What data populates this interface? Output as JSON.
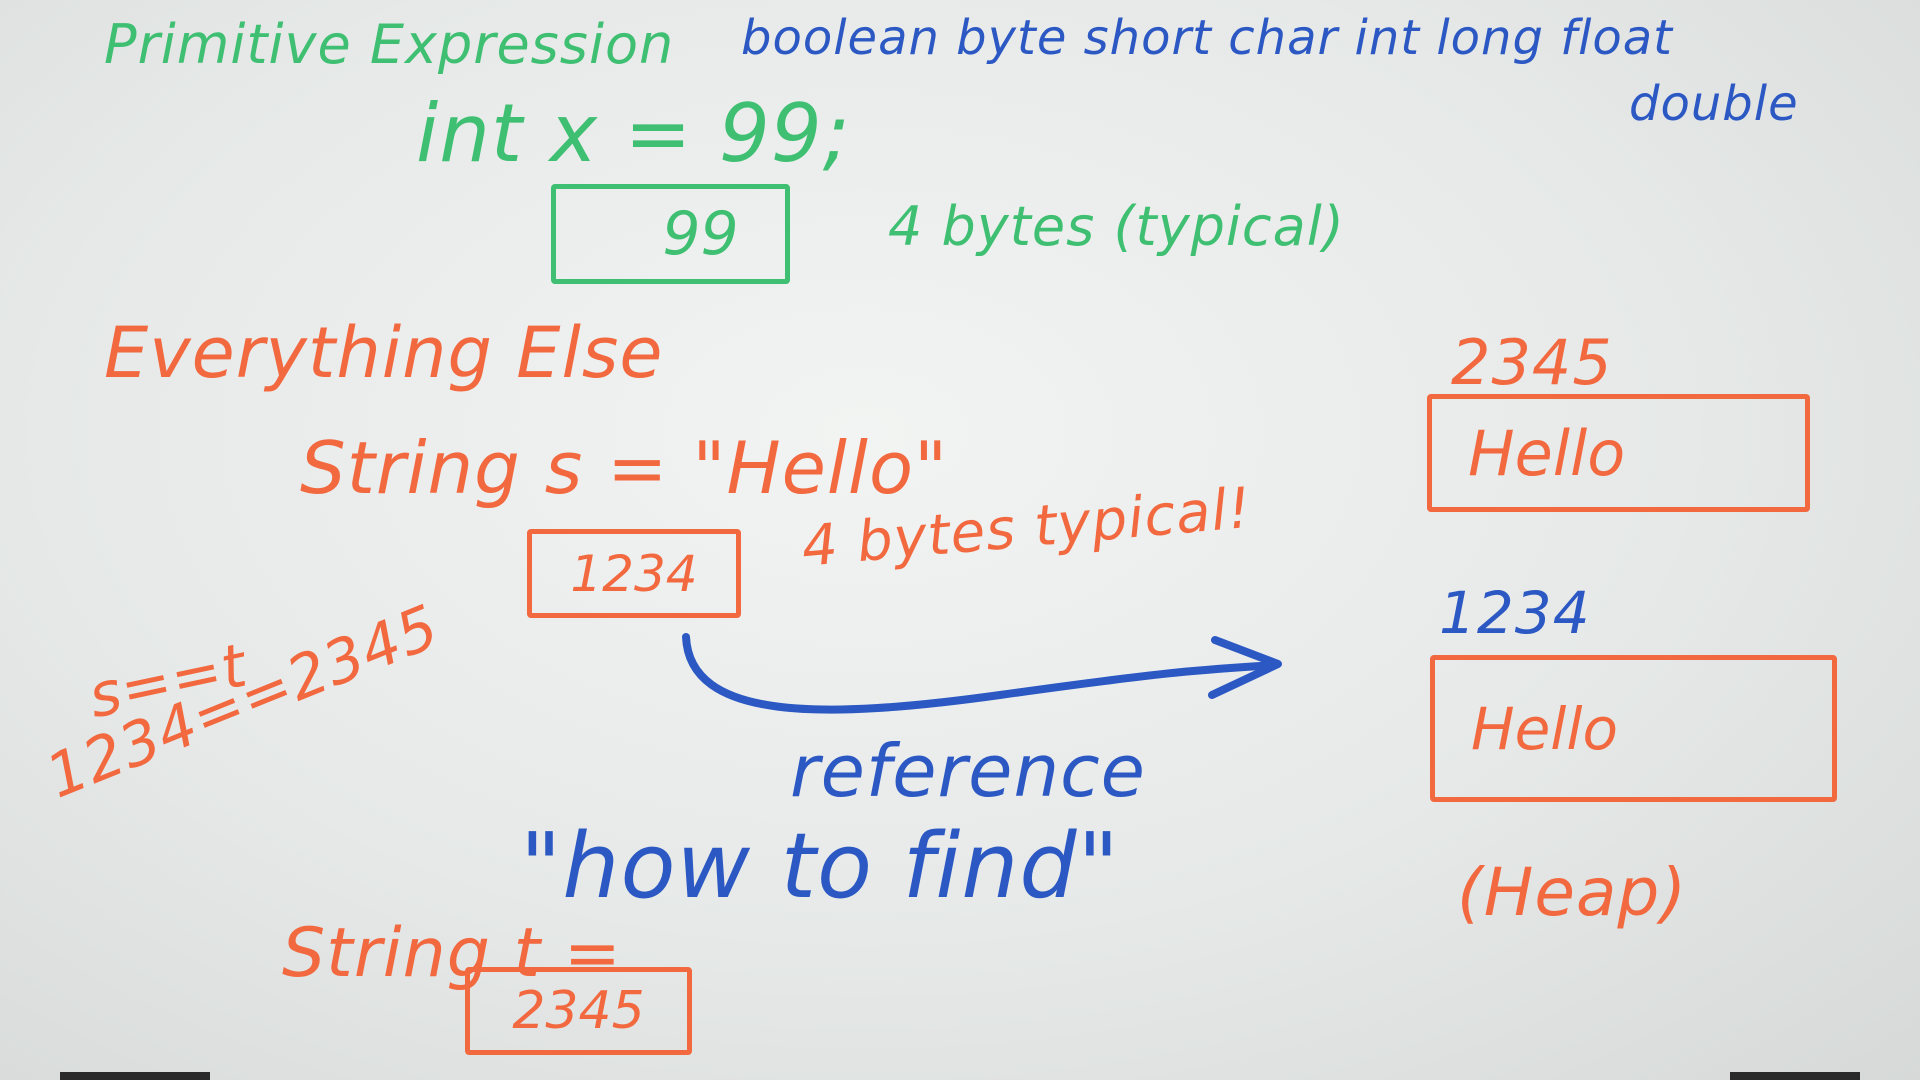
{
  "primitive": {
    "title": "Primitive Expression",
    "types": "boolean byte short char int long float",
    "types_cont": "double",
    "declaration": "int x = 99;",
    "box_value": "99",
    "size_note": "4 bytes (typical)"
  },
  "everything_else": {
    "title": "Everything Else",
    "declaration_s": "String s = \"Hello\"",
    "box_s_value": "1234",
    "size_note": "4 bytes typical!",
    "compare": "s==t",
    "compare_values": "1234==2345",
    "reference_label": "reference",
    "how_to_find": "\"how to find\"",
    "declaration_t": "String t =",
    "box_t_value": "2345"
  },
  "heap": {
    "objects": [
      {
        "address": "2345",
        "value": "Hello"
      },
      {
        "address": "1234",
        "value": "Hello"
      }
    ],
    "label": "(Heap)"
  },
  "colors": {
    "green_marker": "#3fbf72",
    "blue_marker": "#2c58c4",
    "orange_marker": "#f2683f",
    "whiteboard": "#eceeed"
  }
}
